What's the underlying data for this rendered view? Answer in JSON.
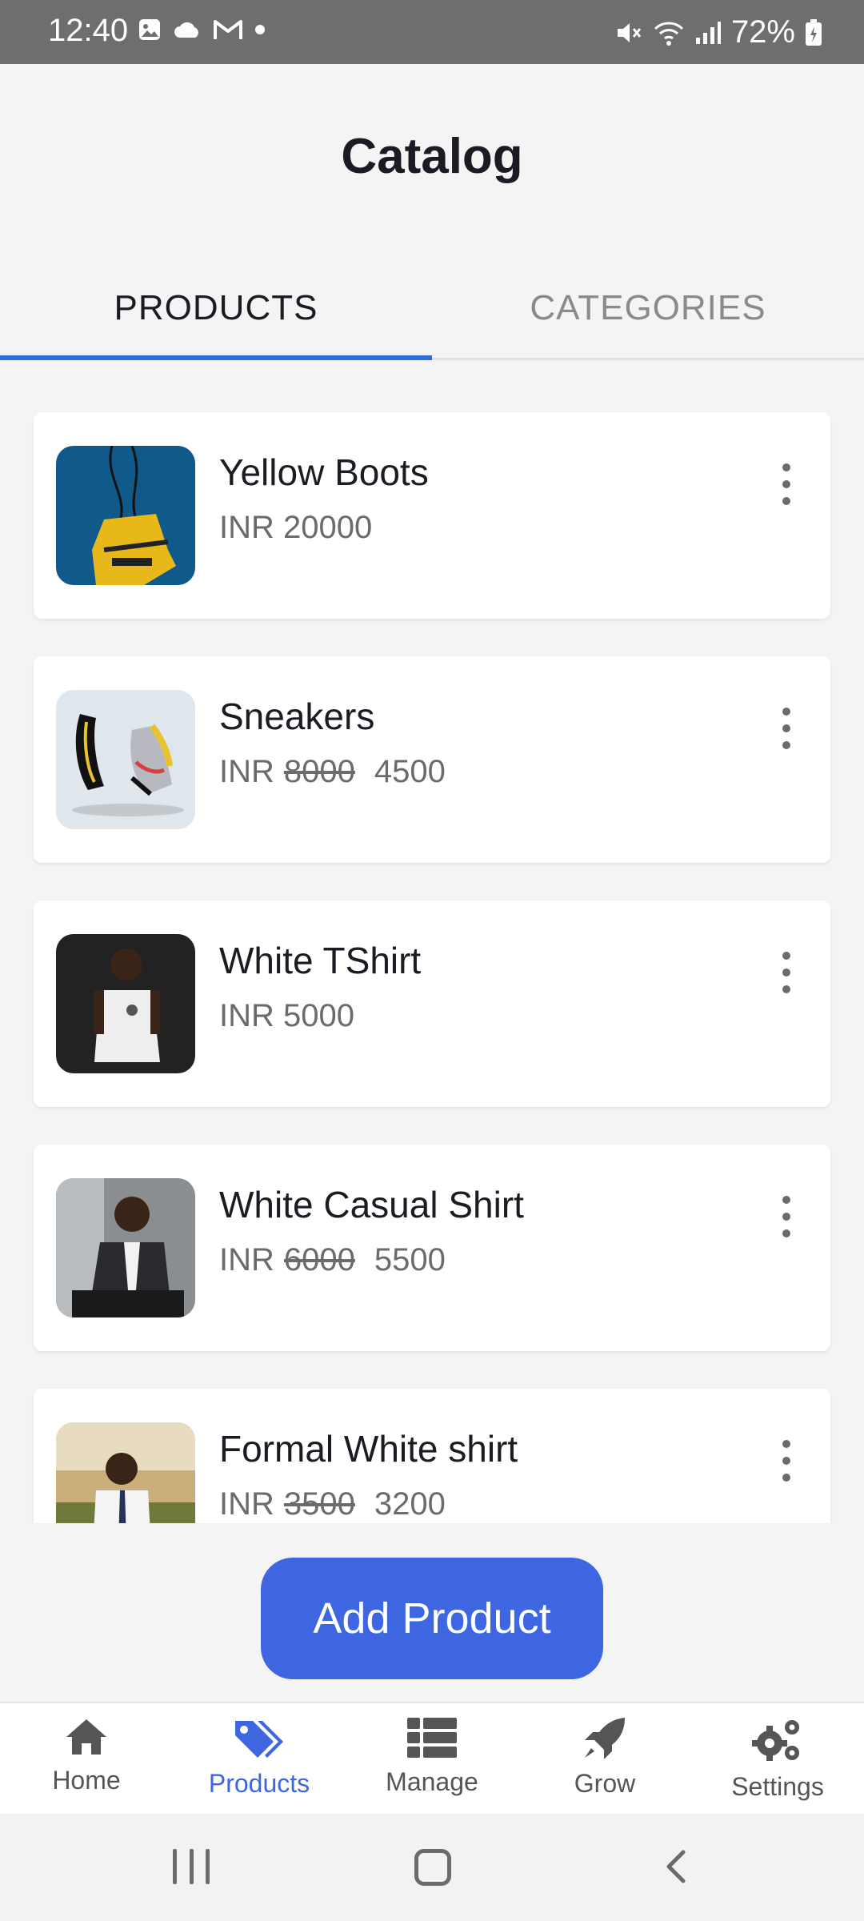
{
  "status_bar": {
    "time": "12:40",
    "battery": "72%",
    "left_icons": [
      "image-icon",
      "cloud-icon",
      "gmail-icon",
      "dot-icon"
    ],
    "right_icons": [
      "mute-icon",
      "wifi-icon",
      "signal-icon",
      "battery-icon"
    ]
  },
  "header": {
    "title": "Catalog"
  },
  "tabs": [
    {
      "label": "PRODUCTS",
      "active": true
    },
    {
      "label": "CATEGORIES",
      "active": false
    }
  ],
  "products": [
    {
      "name": "Yellow Boots",
      "currency": "INR",
      "price": "20000",
      "old_price": ""
    },
    {
      "name": "Sneakers",
      "currency": "INR",
      "old_price": "8000",
      "price": "4500"
    },
    {
      "name": "White TShirt",
      "currency": "INR",
      "price": "5000",
      "old_price": ""
    },
    {
      "name": "White Casual Shirt",
      "currency": "INR",
      "old_price": "6000",
      "price": "5500"
    },
    {
      "name": "Formal White shirt",
      "currency": "INR",
      "old_price": "3500",
      "price": "3200"
    }
  ],
  "actions": {
    "add_product": "Add Product"
  },
  "bottom_nav": [
    {
      "label": "Home",
      "icon": "home-icon",
      "active": false
    },
    {
      "label": "Products",
      "icon": "tag-icon",
      "active": true
    },
    {
      "label": "Manage",
      "icon": "list-icon",
      "active": false
    },
    {
      "label": "Grow",
      "icon": "rocket-icon",
      "active": false
    },
    {
      "label": "Settings",
      "icon": "gears-icon",
      "active": false
    }
  ],
  "colors": {
    "accent": "#3e66e0",
    "tab_indicator": "#2d6de0",
    "status_bar": "#6e6e6e"
  }
}
